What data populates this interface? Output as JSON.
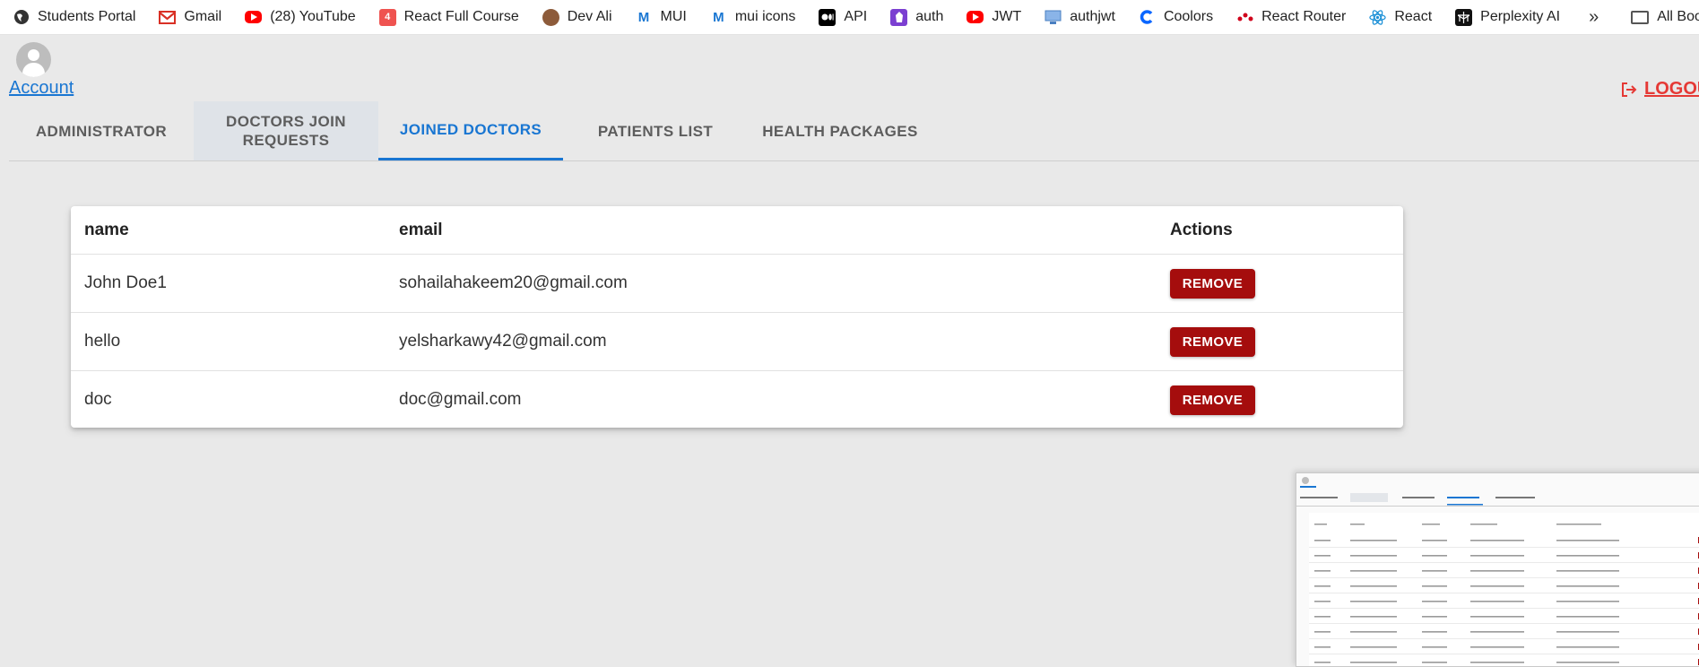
{
  "bookmarks": [
    {
      "label": "Students Portal",
      "icon": "globe-icon",
      "color": "#333333"
    },
    {
      "label": "Gmail",
      "icon": "gmail-icon",
      "color": "#d93025"
    },
    {
      "label": "(28) YouTube",
      "icon": "youtube-icon",
      "color": "#ff0000"
    },
    {
      "label": "React Full Course",
      "icon": "course-icon",
      "color": "#ef5350"
    },
    {
      "label": "Dev Ali",
      "icon": "avatar-icon",
      "color": "#8d5b3a"
    },
    {
      "label": "MUI",
      "icon": "mui-icon",
      "color": "#1976d2"
    },
    {
      "label": "mui icons",
      "icon": "mui-icon",
      "color": "#1976d2"
    },
    {
      "label": "API",
      "icon": "medium-icon",
      "color": "#000000"
    },
    {
      "label": "auth",
      "icon": "auth-icon",
      "color": "#7b3fd1"
    },
    {
      "label": "JWT",
      "icon": "youtube-icon",
      "color": "#ff0000"
    },
    {
      "label": "authjwt",
      "icon": "monitor-icon",
      "color": "#4a7fc1"
    },
    {
      "label": "Coolors",
      "icon": "coolors-icon",
      "color": "#0a66ff"
    },
    {
      "label": "React Router",
      "icon": "react-router-icon",
      "color": "#d0021b"
    },
    {
      "label": "React",
      "icon": "react-icon",
      "color": "#1a8fd6"
    },
    {
      "label": "Perplexity AI",
      "icon": "perplexity-icon",
      "color": "#111111"
    }
  ],
  "bookmarks_more": "»",
  "all_bookmarks": "All Bookmarks",
  "header": {
    "account": "Account",
    "logout": "LOGOUT"
  },
  "tabs": [
    {
      "label": "ADMINISTRATOR"
    },
    {
      "label": "DOCTORS JOIN REQUESTS"
    },
    {
      "label": "JOINED DOCTORS"
    },
    {
      "label": "PATIENTS LIST"
    },
    {
      "label": "HEALTH PACKAGES"
    }
  ],
  "active_tab": "JOINED DOCTORS",
  "table": {
    "headers": {
      "name": "name",
      "email": "email",
      "actions": "Actions"
    },
    "rows": [
      {
        "name": "John Doe1",
        "email": "sohailahakeem20@gmail.com",
        "action": "REMOVE"
      },
      {
        "name": "hello",
        "email": "yelsharkawy42@gmail.com",
        "action": "REMOVE"
      },
      {
        "name": "doc",
        "email": "doc@gmail.com",
        "action": "REMOVE"
      }
    ]
  },
  "colors": {
    "accent": "#1976d2",
    "danger": "#a50d0d",
    "logout": "#e53935"
  }
}
